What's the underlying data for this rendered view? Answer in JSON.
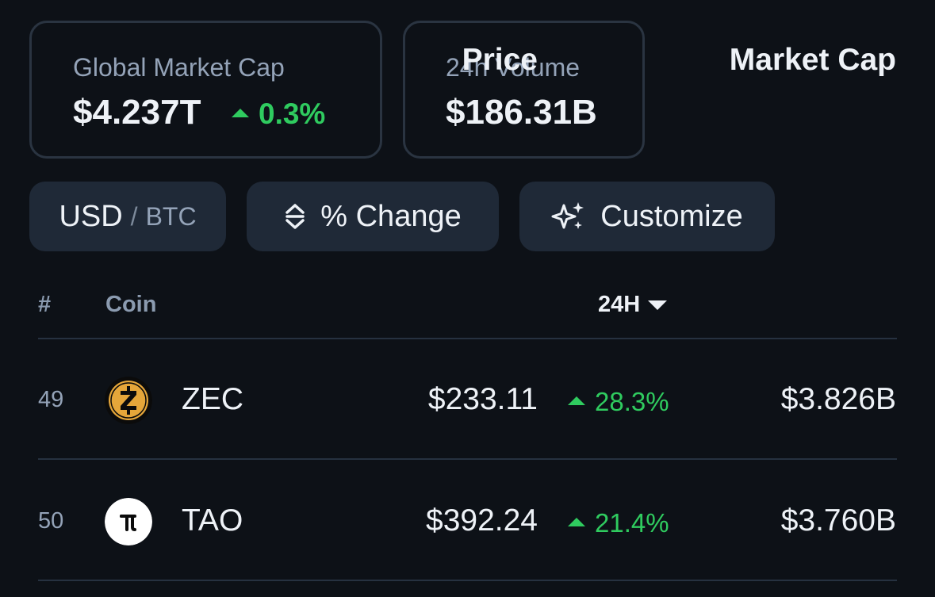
{
  "stats": {
    "market_cap": {
      "label": "Global Market Cap",
      "value": "$4.237T",
      "change": "0.3%",
      "direction": "up"
    },
    "volume": {
      "label": "24h Volume",
      "value": "$186.31B"
    }
  },
  "controls": {
    "currency_primary": "USD",
    "currency_separator": "/",
    "currency_secondary": "BTC",
    "change_label": "% Change",
    "customize_label": "Customize"
  },
  "table": {
    "headers": {
      "rank": "#",
      "coin": "Coin",
      "price": "Price",
      "change": "24H",
      "market_cap": "Market Cap"
    },
    "sort": {
      "column": "24H",
      "direction": "descending"
    },
    "rows": [
      {
        "rank": "49",
        "symbol": "ZEC",
        "price": "$233.11",
        "change": "28.3%",
        "direction": "up",
        "market_cap": "$3.826B",
        "icon": "zec-logo-icon"
      },
      {
        "rank": "50",
        "symbol": "TAO",
        "price": "$392.24",
        "change": "21.4%",
        "direction": "up",
        "market_cap": "$3.760B",
        "icon": "tao-logo-icon"
      }
    ]
  },
  "colors": {
    "background": "#0d1117",
    "card_border": "#2a3441",
    "button_bg": "#1f2937",
    "positive": "#2fcb5f",
    "muted_text": "#94a3b8",
    "primary_text": "#eef2f7"
  }
}
